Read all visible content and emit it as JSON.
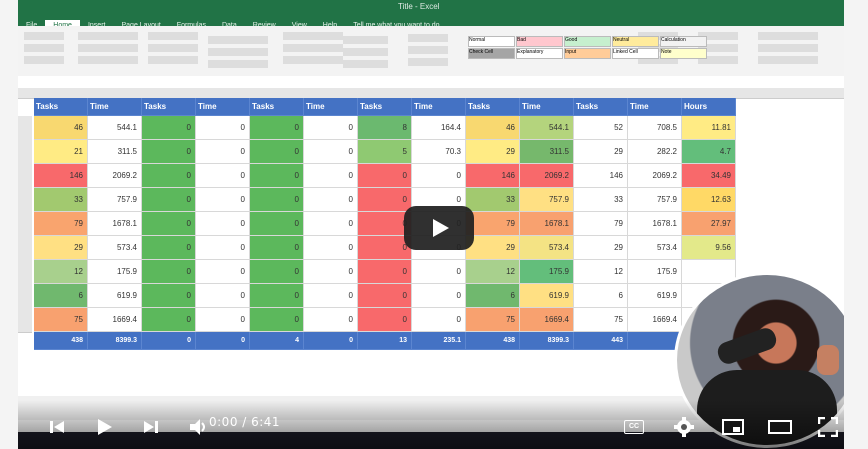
{
  "window": {
    "title": "Title - Excel"
  },
  "menu": [
    "File",
    "Home",
    "Insert",
    "Page Layout",
    "Formulas",
    "Data",
    "Review",
    "View",
    "Help",
    "Tell me what you want to do"
  ],
  "ribbon_styles": [
    {
      "label": "Normal",
      "color": "#ffffff"
    },
    {
      "label": "Bad",
      "color": "#ffc7ce"
    },
    {
      "label": "Good",
      "color": "#c6efce"
    },
    {
      "label": "Neutral",
      "color": "#ffeb9c"
    },
    {
      "label": "Calculation",
      "color": "#f2f2f2"
    },
    {
      "label": "Check Cell",
      "color": "#a5a5a5"
    },
    {
      "label": "Explanatory",
      "color": "#ffffff"
    },
    {
      "label": "Input",
      "color": "#ffcc99"
    },
    {
      "label": "Linked Cell",
      "color": "#ffffff"
    },
    {
      "label": "Note",
      "color": "#ffffcc"
    }
  ],
  "sheet": {
    "headers": [
      "Tasks",
      "Time",
      "Tasks",
      "Time",
      "Tasks",
      "Time",
      "Tasks",
      "Time",
      "Tasks",
      "Time",
      "Tasks",
      "Time",
      "Hours"
    ],
    "rows": [
      [
        "46",
        "544.1",
        "0",
        "0",
        "0",
        "0",
        "8",
        "164.4",
        "46",
        "544.1",
        "52",
        "708.5",
        "11.81"
      ],
      [
        "21",
        "311.5",
        "0",
        "0",
        "0",
        "0",
        "5",
        "70.3",
        "29",
        "311.5",
        "29",
        "282.2",
        "4.7"
      ],
      [
        "146",
        "2069.2",
        "0",
        "0",
        "0",
        "0",
        "0",
        "0",
        "146",
        "2069.2",
        "146",
        "2069.2",
        "34.49"
      ],
      [
        "33",
        "757.9",
        "0",
        "0",
        "0",
        "0",
        "0",
        "0",
        "33",
        "757.9",
        "33",
        "757.9",
        "12.63"
      ],
      [
        "79",
        "1678.1",
        "0",
        "0",
        "0",
        "0",
        "0",
        "0",
        "79",
        "1678.1",
        "79",
        "1678.1",
        "27.97"
      ],
      [
        "29",
        "573.4",
        "0",
        "0",
        "0",
        "0",
        "0",
        "0",
        "29",
        "573.4",
        "29",
        "573.4",
        "9.56"
      ],
      [
        "12",
        "175.9",
        "0",
        "0",
        "0",
        "0",
        "0",
        "0",
        "12",
        "175.9",
        "12",
        "175.9",
        ""
      ],
      [
        "6",
        "619.9",
        "0",
        "0",
        "0",
        "0",
        "0",
        "0",
        "6",
        "619.9",
        "6",
        "619.9",
        ""
      ],
      [
        "75",
        "1669.4",
        "0",
        "0",
        "0",
        "0",
        "0",
        "0",
        "75",
        "1669.4",
        "75",
        "1669.4",
        ""
      ]
    ],
    "totals": [
      "438",
      "8399.3",
      "0",
      "0",
      "4",
      "0",
      "13",
      "235.1",
      "438",
      "8399.3",
      "443",
      "",
      ""
    ],
    "colors": {
      "a": [
        "#f8d870",
        "#ffeb84",
        "#f8696b",
        "#a2c96f",
        "#f9a46e",
        "#ffe083",
        "#a8d08d",
        "#70b86e",
        "#f8a16f"
      ],
      "b": [
        "#ffffff",
        "#ffffff",
        "#ffffff",
        "#ffffff",
        "#ffffff",
        "#ffffff",
        "#ffffff",
        "#ffffff",
        "#ffffff"
      ],
      "g7": [
        "#6bb96f",
        "#8fc972",
        "#f8696b",
        "#f8696b",
        "#f8696b",
        "#f8696b",
        "#f8696b",
        "#f8696b",
        "#f8696b"
      ],
      "g9": [
        "#b4d47d",
        "#76b86c",
        "#f8696b",
        "#ffe083",
        "#f8a16f",
        "#f4e384",
        "#63be7b",
        "#ffe083",
        "#f8a16f"
      ],
      "hours": [
        "#ffeb84",
        "#63be7b",
        "#f8696b",
        "#ffd966",
        "#f8a16f",
        "#e3e98a",
        "",
        "",
        ""
      ],
      "green": "#5cb85c",
      "header": "#4472c4"
    }
  },
  "player": {
    "time": "0:00 / 6:41",
    "cc": "CC",
    "icons": [
      "skip-back-icon",
      "play-icon",
      "skip-forward-icon",
      "volume-icon",
      "settings-icon",
      "miniplayer-icon",
      "theater-icon",
      "fullscreen-icon"
    ]
  }
}
